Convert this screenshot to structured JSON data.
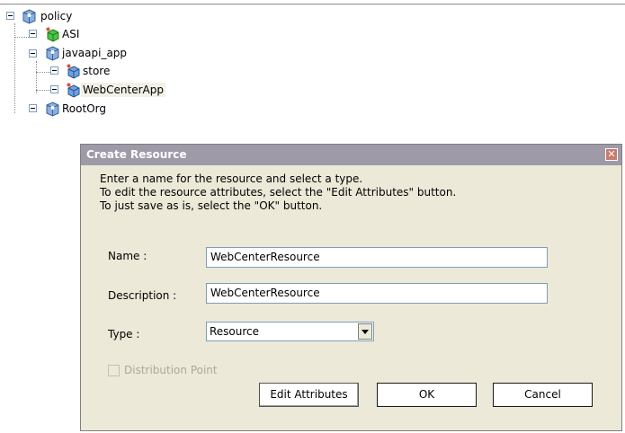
{
  "tree": {
    "nodes": [
      {
        "id": "policy",
        "label": "policy",
        "expander": "minus",
        "icon": "org-icon"
      },
      {
        "id": "asi",
        "label": "ASI",
        "expander": "plus",
        "icon": "app-green-icon"
      },
      {
        "id": "javaapi_app",
        "label": "javaapi_app",
        "expander": "minus",
        "icon": "org-icon"
      },
      {
        "id": "store",
        "label": "store",
        "expander": "plus",
        "icon": "app-blue-icon"
      },
      {
        "id": "webcenterapp",
        "label": "WebCenterApp",
        "expander": "plus",
        "icon": "app-blue-icon",
        "selected": true
      },
      {
        "id": "rootorg",
        "label": "RootOrg",
        "expander": "plus",
        "icon": "org-icon"
      }
    ]
  },
  "dialog": {
    "title": "Create Resource",
    "close_glyph": "✕",
    "instructions": [
      "Enter a name for the resource and select a type.",
      "To edit the resource attributes, select the \"Edit Attributes\" button.",
      "To just save as is, select the \"OK\" button."
    ],
    "name_label": "Name :",
    "name_value": "WebCenterResource",
    "description_label": "Description :",
    "description_value": "WebCenterResource",
    "type_label": "Type :",
    "type_value": "Resource",
    "distribution_point_label": "Distribution Point",
    "distribution_point_checked": false,
    "edit_attributes_label": "Edit Attributes",
    "ok_label": "OK",
    "cancel_label": "Cancel"
  },
  "colors": {
    "titlebar": "#9f9aa8",
    "dialog_bg": "#ece9d8",
    "selected_bg": "#f3f1e6"
  }
}
